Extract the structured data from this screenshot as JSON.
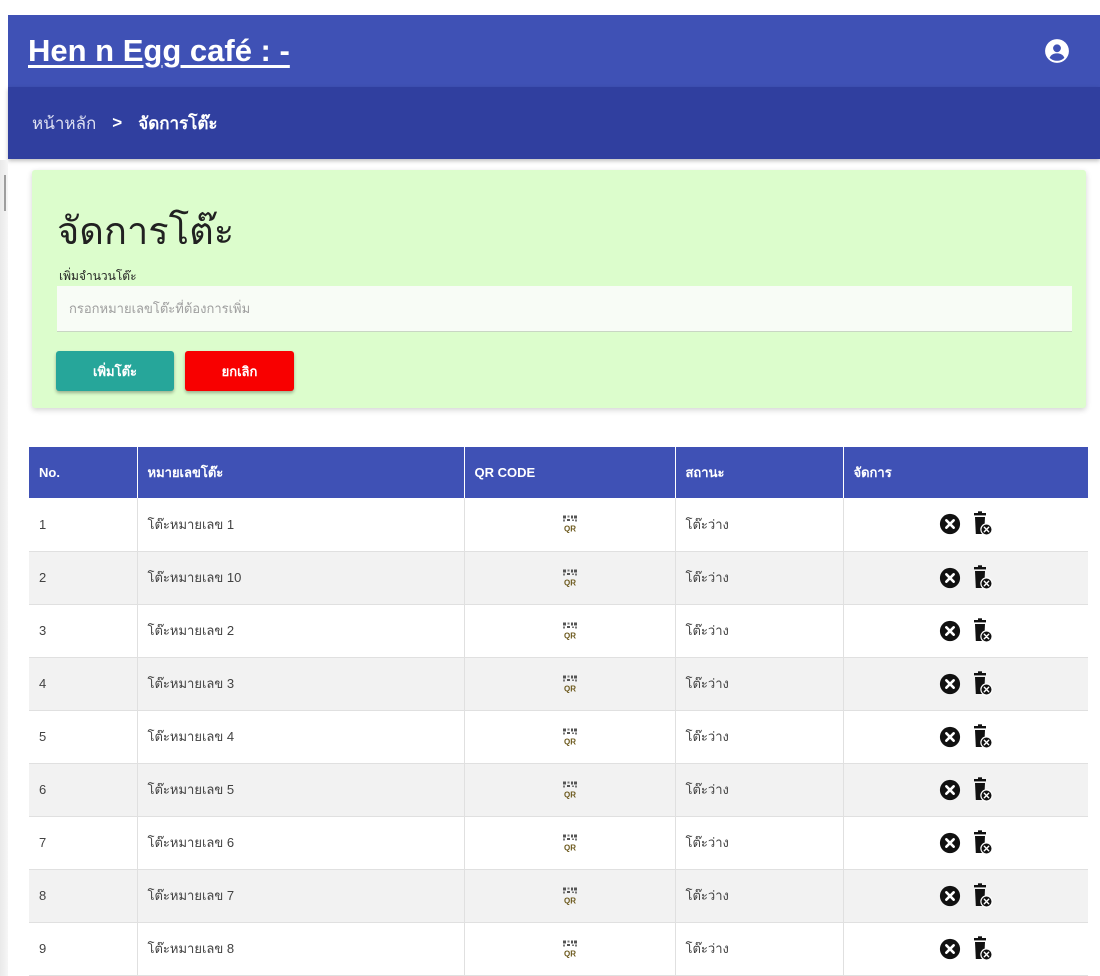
{
  "header": {
    "app_title": "Hen n Egg café : -",
    "account_icon": "account-circle-icon"
  },
  "breadcrumb": {
    "home": "หน้าหลัก",
    "separator": ">",
    "current": "จัดการโต๊ะ"
  },
  "form": {
    "title": "จัดการโต๊ะ",
    "label": "เพิ่มจำนวนโต๊ะ",
    "input_value": "",
    "input_placeholder": "กรอกหมายเลขโต๊ะที่ต้องการเพิ่ม",
    "add_button": "เพิ่มโต๊ะ",
    "cancel_button": "ยกเลิก"
  },
  "table": {
    "headers": [
      "No.",
      "หมายเลขโต๊ะ",
      "QR CODE",
      "สถานะ",
      "จัดการ"
    ],
    "rows": [
      {
        "no": "1",
        "name": "โต๊ะหมายเลข 1",
        "status": "โต๊ะว่าง"
      },
      {
        "no": "2",
        "name": "โต๊ะหมายเลข 10",
        "status": "โต๊ะว่าง"
      },
      {
        "no": "3",
        "name": "โต๊ะหมายเลข 2",
        "status": "โต๊ะว่าง"
      },
      {
        "no": "4",
        "name": "โต๊ะหมายเลข 3",
        "status": "โต๊ะว่าง"
      },
      {
        "no": "5",
        "name": "โต๊ะหมายเลข 4",
        "status": "โต๊ะว่าง"
      },
      {
        "no": "6",
        "name": "โต๊ะหมายเลข 5",
        "status": "โต๊ะว่าง"
      },
      {
        "no": "7",
        "name": "โต๊ะหมายเลข 6",
        "status": "โต๊ะว่าง"
      },
      {
        "no": "8",
        "name": "โต๊ะหมายเลข 7",
        "status": "โต๊ะว่าง"
      },
      {
        "no": "9",
        "name": "โต๊ะหมายเลข 8",
        "status": "โต๊ะว่าง"
      }
    ],
    "row_icons": {
      "qr": "qr-code-icon",
      "close": "close-circle-icon",
      "delete": "trash-icon"
    }
  },
  "colors": {
    "primary": "#3f51b5",
    "primary_dark": "#303f9f",
    "card_background": "#dcfdcc",
    "add_button": "#26a69a",
    "cancel_button": "#f80000"
  }
}
